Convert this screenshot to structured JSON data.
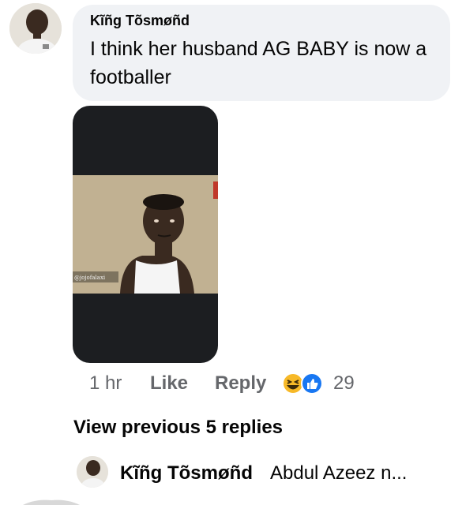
{
  "comment": {
    "author": "Kĩñg Tõsmøñd",
    "text": "I think her husband AG BABY is now a footballer",
    "media": {
      "watermark": "@jojofalaxi"
    },
    "time": "1 hr",
    "like_label": "Like",
    "reply_label": "Reply",
    "reactions": {
      "icons": [
        "haha-icon",
        "like-icon"
      ],
      "count": "29"
    }
  },
  "replies": {
    "view_previous_label": "View previous 5 replies",
    "latest": {
      "author": "Kĩñg Tõsmøñd",
      "preview": "Abdul Azeez n..."
    }
  },
  "colors": {
    "bubble": "#f0f2f5",
    "meta_text": "#65676b",
    "primary_text": "#050505",
    "media_bg": "#1c1e21",
    "like_blue": "#1877f2",
    "haha_yellow": "#f7b928"
  }
}
